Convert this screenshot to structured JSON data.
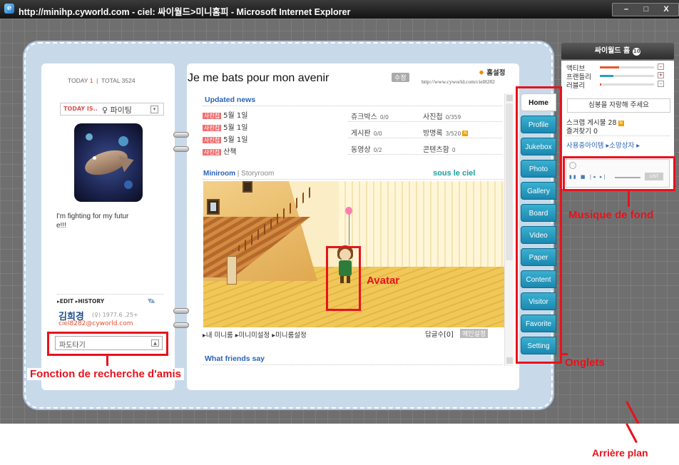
{
  "window": {
    "title": "http://minihp.cyworld.com - ciel: 싸이월드>미니홈피 - Microsoft Internet Explorer",
    "buttons": {
      "minimize": "–",
      "maximize": "□",
      "close": "X"
    }
  },
  "header": {
    "today_label": "TODAY",
    "today_count": "1",
    "total_label": "TOTAL",
    "total_count": "3524",
    "home_title": "Je me bats pour mon avenir",
    "edit_button": "수정",
    "home_settings": "홈설정",
    "home_url": "http://www.cyworld.com/ciel8282"
  },
  "profile": {
    "mood_label": "TODAY IS..",
    "mood_value": "♀ 파이팅",
    "intro_text": "I'm fighting for my futur\ne!!!",
    "edit_history": "▸EDIT ▸HISTORY",
    "name": "김희경",
    "info": "(♀) 1977.6 .25+",
    "email": "ciel8282@cyworld.com",
    "friend_search_placeholder": "파도타기"
  },
  "news": {
    "title": "Updated news",
    "items": [
      {
        "tag": "사진첩",
        "text": "5월 1일"
      },
      {
        "tag": "사진첩",
        "text": "5월 1일"
      },
      {
        "tag": "사진첩",
        "text": "5월 1일"
      },
      {
        "tag": "사진첩",
        "text": "산책"
      }
    ],
    "stats": [
      {
        "label": "쥬크박스",
        "value": "0/0"
      },
      {
        "label": "사진첩",
        "value": "0/359"
      },
      {
        "label": "게시판",
        "value": "0/0"
      },
      {
        "label": "방명록",
        "value": "3/520"
      },
      {
        "label": "동영상",
        "value": "0/2"
      },
      {
        "label": "콘텐츠함",
        "value": "0"
      }
    ]
  },
  "miniroom": {
    "tab_active": "Miniroom",
    "separator": "|",
    "tab_other": "Storyroom",
    "room_name": "sous le ciel",
    "links": "▸내 미니룸 ▸미니미설정 ▸미니룸설정",
    "replies": "답글수[0]",
    "main_setting": "메인설정"
  },
  "friends": {
    "title": "What friends say"
  },
  "tabs": [
    "Home",
    "Profile",
    "Jukebox",
    "Photo",
    "Gallery",
    "Board",
    "Video",
    "Paper",
    "Content",
    "Visitor",
    "Favorite",
    "Setting"
  ],
  "widget": {
    "cyworld_home": "싸이월드 홈",
    "cyworld_home_badge": "10",
    "bars": [
      {
        "label": "액티브",
        "level": 0.35,
        "color": "#e85a2a"
      },
      {
        "label": "프랜들리",
        "level": 0.25,
        "color": "#2aa0c0"
      },
      {
        "label": "러블리",
        "level": 0.02,
        "color": "#e85a2a"
      }
    ],
    "praise_button": "심봉을 자랑해 주세요",
    "scrap_label": "스크랩 게시물",
    "scrap_count": "28",
    "favorites_label": "즐겨찾기",
    "favorites_count": "0",
    "links": "사용중아이템 ▸소망상자 ▸",
    "player_controls": "▮▮ ■ |◂ ▸|",
    "player_list": "LIST"
  },
  "annotations": {
    "friend_search": "Fonction de recherche d'amis",
    "avatar": "Avatar",
    "music": "Musique de fond",
    "tabs": "Onglets",
    "background": "Arrière plan"
  },
  "colors": {
    "annotation_red": "#e8121c",
    "tab_blue": "#1b88b0",
    "title_blue": "#2a63b8",
    "binder": "#c8daea"
  }
}
